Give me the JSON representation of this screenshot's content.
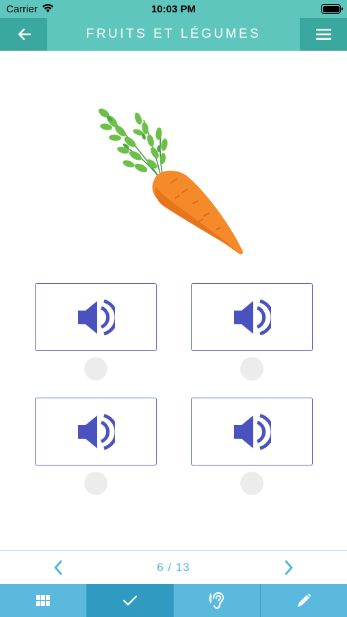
{
  "status_bar": {
    "carrier": "Carrier",
    "time": "10:03 PM",
    "wifi_icon": "wifi-icon",
    "battery_icon": "battery-icon"
  },
  "header": {
    "title": "FRUITS ET LÉGUMES",
    "back_icon": "arrow-left-icon",
    "menu_icon": "hamburger-menu-icon",
    "background": "#5ec6bd",
    "button_background": "#3aa89e"
  },
  "question": {
    "image": "carrot-image"
  },
  "options": [
    {
      "icon": "speaker-icon",
      "selected": false
    },
    {
      "icon": "speaker-icon",
      "selected": false
    },
    {
      "icon": "speaker-icon",
      "selected": false
    },
    {
      "icon": "speaker-icon",
      "selected": false
    }
  ],
  "pager": {
    "current": 6,
    "total": 13,
    "label": "6 / 13",
    "prev_icon": "chevron-left-icon",
    "next_icon": "chevron-right-icon"
  },
  "tabs": [
    {
      "icon": "grid-icon",
      "active": false
    },
    {
      "icon": "check-icon",
      "active": true
    },
    {
      "icon": "ear-icon",
      "active": false
    },
    {
      "icon": "pencil-icon",
      "active": false
    }
  ],
  "colors": {
    "accent": "#5b62c0",
    "speaker": "#4a52bd",
    "pager_text": "#4fb6dd",
    "tabbar": "#5bb9dd",
    "tab_active": "#2f9bc0"
  }
}
